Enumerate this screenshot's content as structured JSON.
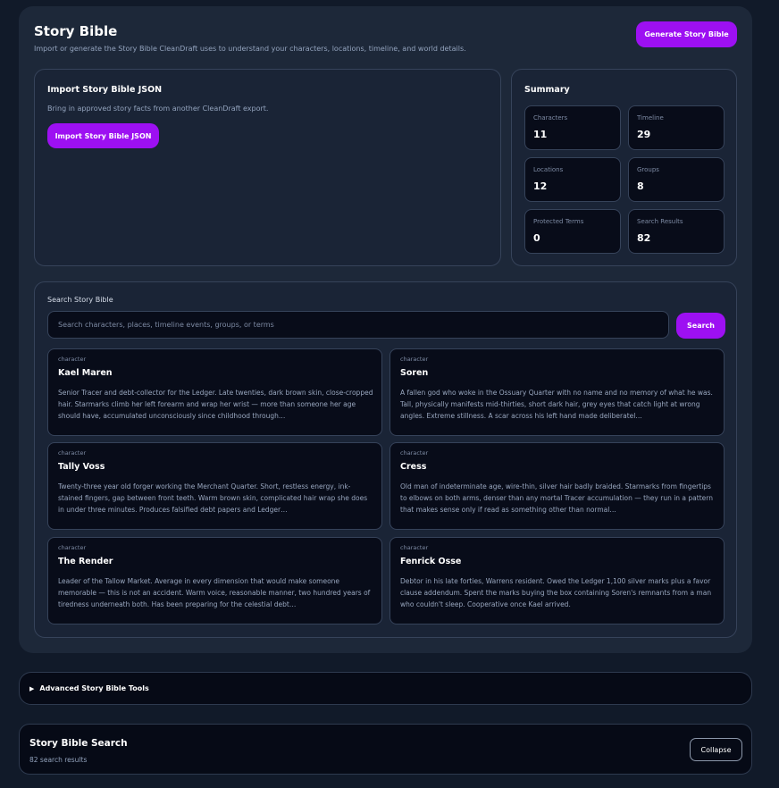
{
  "header": {
    "title": "Story Bible",
    "subtitle": "Import or generate the Story Bible CleanDraft uses to understand your characters, locations, timeline, and world details.",
    "generate_label": "Generate Story Bible"
  },
  "import": {
    "title": "Import Story Bible JSON",
    "description": "Bring in approved story facts from another CleanDraft export.",
    "button_label": "Import Story Bible JSON"
  },
  "summary": {
    "title": "Summary",
    "stats": [
      {
        "label": "Characters",
        "value": "11"
      },
      {
        "label": "Timeline",
        "value": "29"
      },
      {
        "label": "Locations",
        "value": "12"
      },
      {
        "label": "Groups",
        "value": "8"
      },
      {
        "label": "Protected Terms",
        "value": "0"
      },
      {
        "label": "Search Results",
        "value": "82"
      }
    ]
  },
  "search": {
    "label": "Search Story Bible",
    "placeholder": "Search characters, places, timeline events, groups, or terms",
    "value": "",
    "button_label": "Search",
    "results": [
      {
        "type": "character",
        "name": "Kael Maren",
        "description": "Senior Tracer and debt-collector for the Ledger. Late twenties, dark brown skin, close-cropped hair. Starmarks climb her left forearm and wrap her wrist — more than someone her age should have, accumulated unconsciously since childhood through…"
      },
      {
        "type": "character",
        "name": "Soren",
        "description": "A fallen god who woke in the Ossuary Quarter with no name and no memory of what he was. Tall, physically manifests mid-thirties, short dark hair, grey eyes that catch light at wrong angles. Extreme stillness. A scar across his left hand made deliberatel…"
      },
      {
        "type": "character",
        "name": "Tally Voss",
        "description": "Twenty-three year old forger working the Merchant Quarter. Short, restless energy, ink-stained fingers, gap between front teeth. Warm brown skin, complicated hair wrap she does in under three minutes. Produces falsified debt papers and Ledger…"
      },
      {
        "type": "character",
        "name": "Cress",
        "description": "Old man of indeterminate age, wire-thin, silver hair badly braided. Starmarks from fingertips to elbows on both arms, denser than any mortal Tracer accumulation — they run in a pattern that makes sense only if read as something other than normal…"
      },
      {
        "type": "character",
        "name": "The Render",
        "description": "Leader of the Tallow Market. Average in every dimension that would make someone memorable — this is not an accident. Warm voice, reasonable manner, two hundred years of tiredness underneath both. Has been preparing for the celestial debt…"
      },
      {
        "type": "character",
        "name": "Fenrick Osse",
        "description": "Debtor in his late forties, Warrens resident. Owed the Ledger 1,100 silver marks plus a favor clause addendum. Spent the marks buying the box containing Soren's remnants from a man who couldn't sleep. Cooperative once Kael arrived."
      }
    ]
  },
  "advanced": {
    "caret": "▶",
    "label": "Advanced Story Bible Tools"
  },
  "story_bible_search": {
    "title": "Story Bible Search",
    "count_text": "82 search results",
    "collapse_label": "Collapse"
  }
}
